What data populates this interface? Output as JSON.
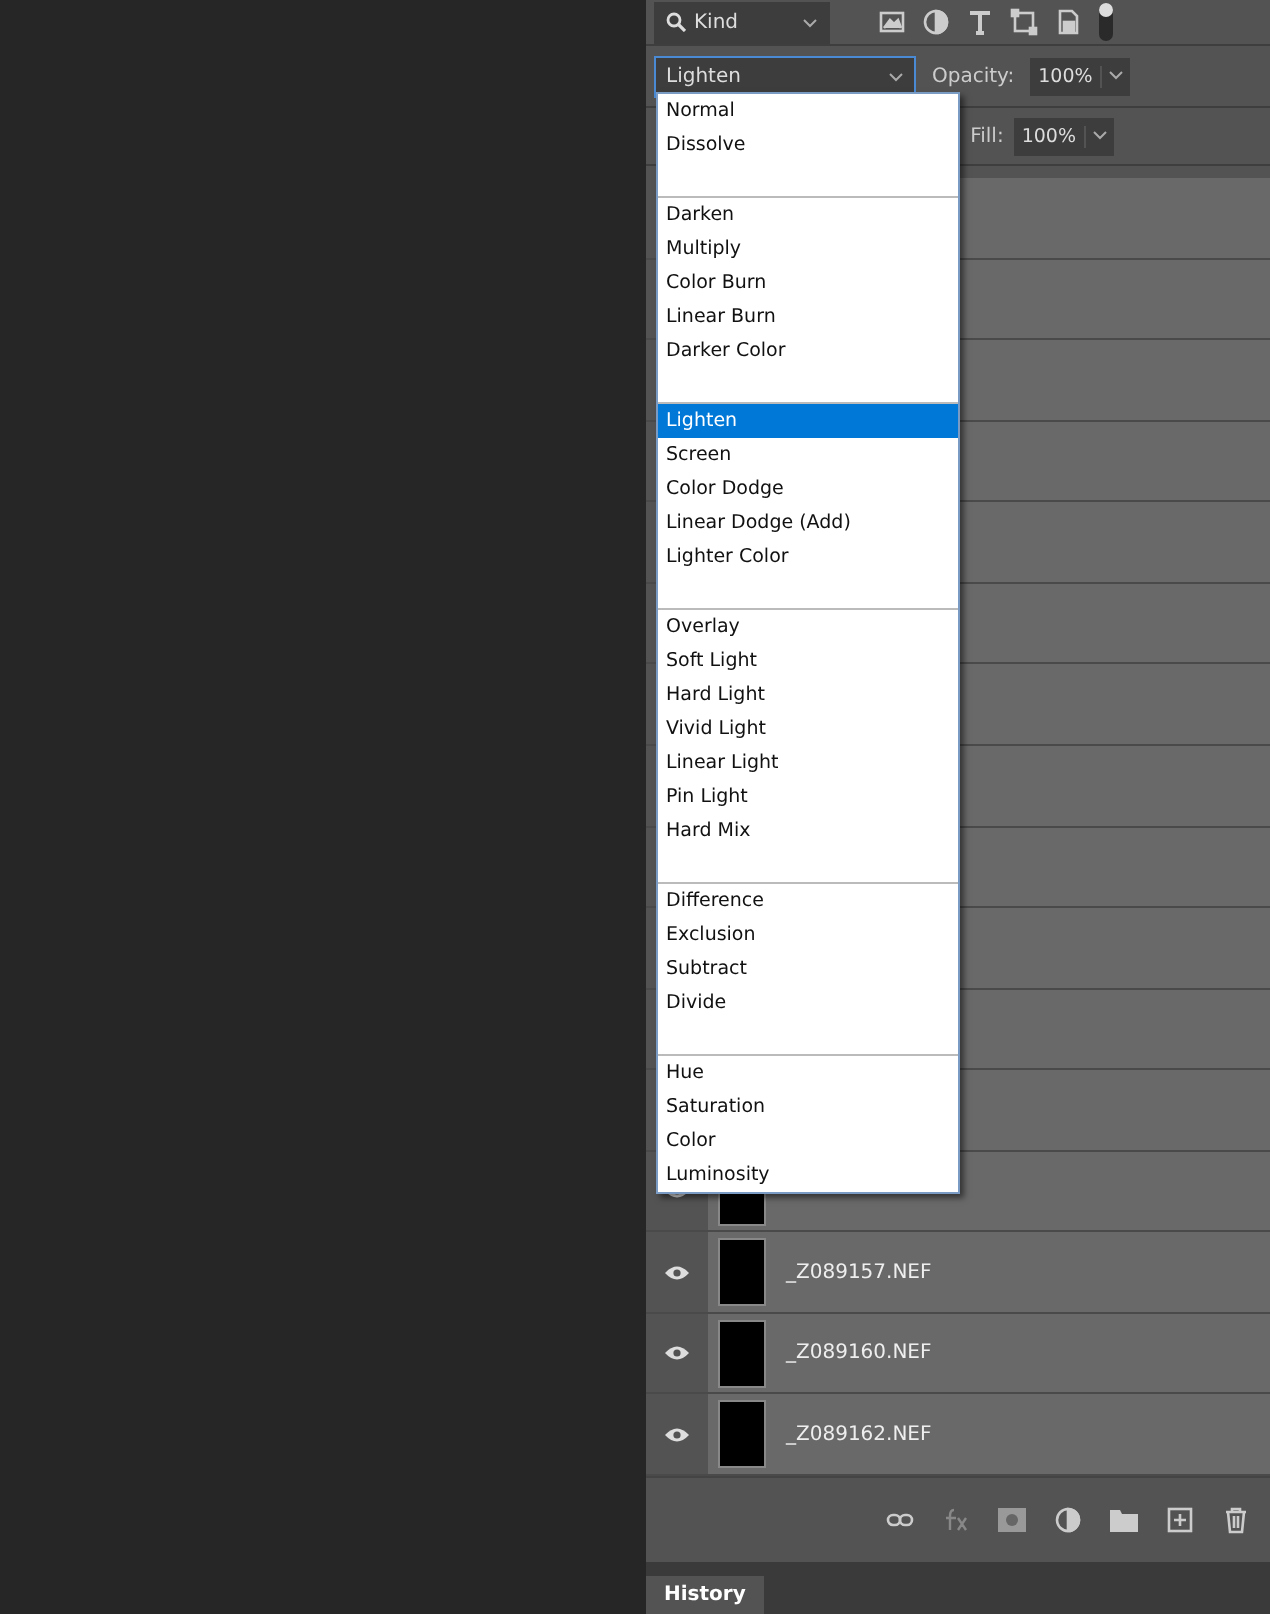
{
  "filter": {
    "label": "Kind"
  },
  "blend": {
    "value": "Lighten",
    "expanded": true
  },
  "opacity": {
    "label": "Opacity:",
    "value": "100%"
  },
  "fill": {
    "label": "Fill:",
    "value": "100%"
  },
  "blend_menu": [
    {
      "items": [
        {
          "label": "Normal",
          "selected": false
        },
        {
          "label": "Dissolve",
          "selected": false
        }
      ]
    },
    {
      "items": [
        {
          "label": "Darken",
          "selected": false
        },
        {
          "label": "Multiply",
          "selected": false
        },
        {
          "label": "Color Burn",
          "selected": false
        },
        {
          "label": "Linear Burn",
          "selected": false
        },
        {
          "label": "Darker Color",
          "selected": false
        }
      ]
    },
    {
      "items": [
        {
          "label": "Lighten",
          "selected": true
        },
        {
          "label": "Screen",
          "selected": false
        },
        {
          "label": "Color Dodge",
          "selected": false
        },
        {
          "label": "Linear Dodge (Add)",
          "selected": false
        },
        {
          "label": "Lighter Color",
          "selected": false
        }
      ]
    },
    {
      "items": [
        {
          "label": "Overlay",
          "selected": false
        },
        {
          "label": "Soft Light",
          "selected": false
        },
        {
          "label": "Hard Light",
          "selected": false
        },
        {
          "label": "Vivid Light",
          "selected": false
        },
        {
          "label": "Linear Light",
          "selected": false
        },
        {
          "label": "Pin Light",
          "selected": false
        },
        {
          "label": "Hard Mix",
          "selected": false
        }
      ]
    },
    {
      "items": [
        {
          "label": "Difference",
          "selected": false
        },
        {
          "label": "Exclusion",
          "selected": false
        },
        {
          "label": "Subtract",
          "selected": false
        },
        {
          "label": "Divide",
          "selected": false
        }
      ]
    },
    {
      "items": [
        {
          "label": "Hue",
          "selected": false
        },
        {
          "label": "Saturation",
          "selected": false
        },
        {
          "label": "Color",
          "selected": false
        },
        {
          "label": "Luminosity",
          "selected": false
        }
      ]
    }
  ],
  "layers": [
    {
      "name": "_Z089157.NEF",
      "visible": true
    },
    {
      "name": "_Z089160.NEF",
      "visible": true
    },
    {
      "name": "_Z089162.NEF",
      "visible": true
    }
  ],
  "tabs": [
    {
      "label": "History",
      "selected": true
    }
  ]
}
